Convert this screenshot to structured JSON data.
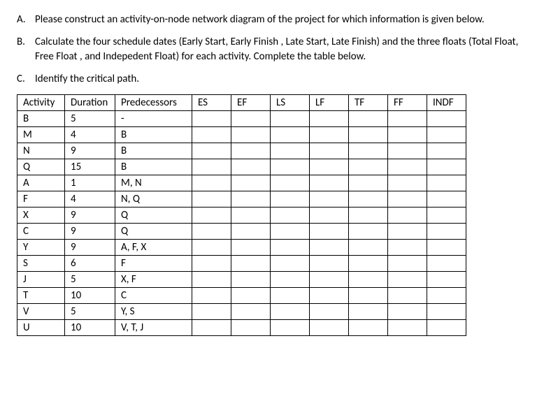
{
  "questions": [
    {
      "marker": "A.",
      "text": "Please construct an activity-on-node network diagram of the project for which information is given below."
    },
    {
      "marker": "B.",
      "text": "Calculate the four schedule dates (Early Start, Early Finish , Late Start, Late Finish) and the three floats (Total Float, Free Float , and Indepedent Float) for each activity. Complete the table below."
    },
    {
      "marker": "C.",
      "text": "Identify the critical path."
    }
  ],
  "table": {
    "headers": {
      "activity": "Activity",
      "duration": "Duration",
      "predecessors": "Predecessors",
      "es": "ES",
      "ef": "EF",
      "ls": "LS",
      "lf": "LF",
      "tf": "TF",
      "ff": "FF",
      "indf": "INDF"
    },
    "rows": [
      {
        "activity": "B",
        "duration": "5",
        "predecessors": "-",
        "es": "",
        "ef": "",
        "ls": "",
        "lf": "",
        "tf": "",
        "ff": "",
        "indf": ""
      },
      {
        "activity": "M",
        "duration": "4",
        "predecessors": "B",
        "es": "",
        "ef": "",
        "ls": "",
        "lf": "",
        "tf": "",
        "ff": "",
        "indf": ""
      },
      {
        "activity": "N",
        "duration": "9",
        "predecessors": "B",
        "es": "",
        "ef": "",
        "ls": "",
        "lf": "",
        "tf": "",
        "ff": "",
        "indf": ""
      },
      {
        "activity": "Q",
        "duration": "15",
        "predecessors": "B",
        "es": "",
        "ef": "",
        "ls": "",
        "lf": "",
        "tf": "",
        "ff": "",
        "indf": ""
      },
      {
        "activity": "A",
        "duration": "1",
        "predecessors": "M, N",
        "es": "",
        "ef": "",
        "ls": "",
        "lf": "",
        "tf": "",
        "ff": "",
        "indf": ""
      },
      {
        "activity": "F",
        "duration": "4",
        "predecessors": "N, Q",
        "es": "",
        "ef": "",
        "ls": "",
        "lf": "",
        "tf": "",
        "ff": "",
        "indf": ""
      },
      {
        "activity": "X",
        "duration": "9",
        "predecessors": "Q",
        "es": "",
        "ef": "",
        "ls": "",
        "lf": "",
        "tf": "",
        "ff": "",
        "indf": ""
      },
      {
        "activity": "C",
        "duration": "9",
        "predecessors": "Q",
        "es": "",
        "ef": "",
        "ls": "",
        "lf": "",
        "tf": "",
        "ff": "",
        "indf": ""
      },
      {
        "activity": "Y",
        "duration": "9",
        "predecessors": "A, F, X",
        "es": "",
        "ef": "",
        "ls": "",
        "lf": "",
        "tf": "",
        "ff": "",
        "indf": ""
      },
      {
        "activity": "S",
        "duration": "6",
        "predecessors": "F",
        "es": "",
        "ef": "",
        "ls": "",
        "lf": "",
        "tf": "",
        "ff": "",
        "indf": ""
      },
      {
        "activity": "J",
        "duration": "5",
        "predecessors": "X, F",
        "es": "",
        "ef": "",
        "ls": "",
        "lf": "",
        "tf": "",
        "ff": "",
        "indf": ""
      },
      {
        "activity": "T",
        "duration": "10",
        "predecessors": "C",
        "es": "",
        "ef": "",
        "ls": "",
        "lf": "",
        "tf": "",
        "ff": "",
        "indf": ""
      },
      {
        "activity": "V",
        "duration": "5",
        "predecessors": "Y, S",
        "es": "",
        "ef": "",
        "ls": "",
        "lf": "",
        "tf": "",
        "ff": "",
        "indf": ""
      },
      {
        "activity": "U",
        "duration": "10",
        "predecessors": "V, T, J",
        "es": "",
        "ef": "",
        "ls": "",
        "lf": "",
        "tf": "",
        "ff": "",
        "indf": ""
      }
    ]
  }
}
